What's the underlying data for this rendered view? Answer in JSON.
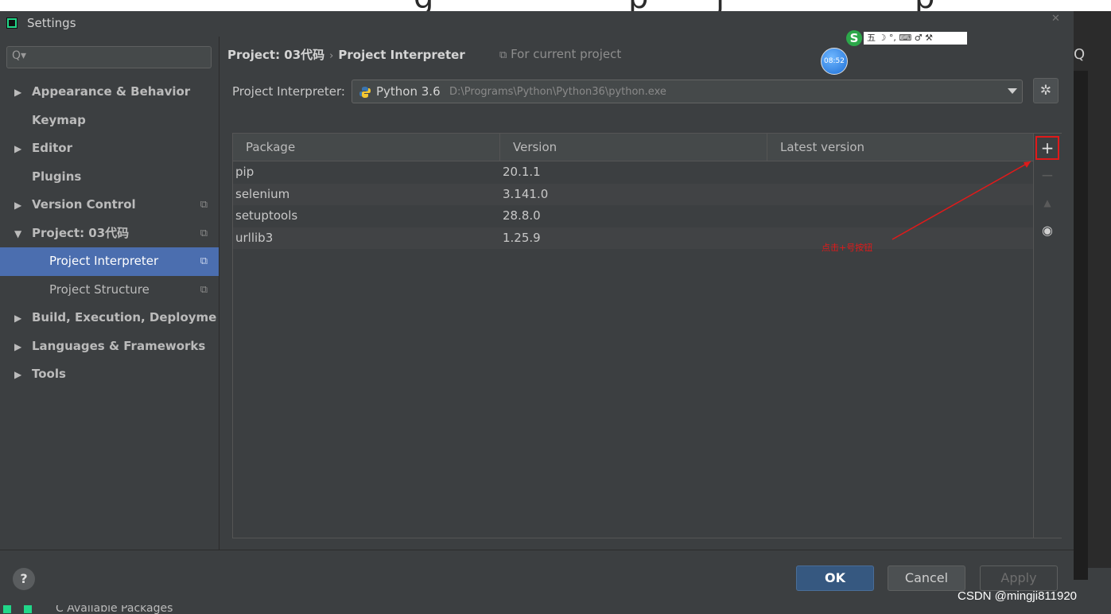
{
  "window": {
    "title": "Settings"
  },
  "sidebar": {
    "items": [
      {
        "label": "Appearance & Behavior",
        "arrow": "▶"
      },
      {
        "label": "Keymap",
        "arrow": ""
      },
      {
        "label": "Editor",
        "arrow": "▶"
      },
      {
        "label": "Plugins",
        "arrow": ""
      },
      {
        "label": "Version Control",
        "arrow": "▶"
      },
      {
        "label": "Project: 03代码",
        "arrow": "▼"
      },
      {
        "label": "Project Interpreter",
        "arrow": ""
      },
      {
        "label": "Project Structure",
        "arrow": ""
      },
      {
        "label": "Build, Execution, Deployme",
        "arrow": "▶"
      },
      {
        "label": "Languages & Frameworks",
        "arrow": "▶"
      },
      {
        "label": "Tools",
        "arrow": "▶"
      }
    ]
  },
  "header": {
    "project": "Project: 03代码",
    "separator": "›",
    "page": "Project Interpreter",
    "scope": "For current project"
  },
  "ime": {
    "brand": "S",
    "text": "五 ☽ °, ⌨ ♂ ⚒"
  },
  "clock": {
    "time": "08:52"
  },
  "interpreter": {
    "label": "Project Interpreter:",
    "name": "Python 3.6",
    "path": "D:\\Programs\\Python\\Python36\\python.exe"
  },
  "packages": {
    "columns": [
      "Package",
      "Version",
      "Latest version"
    ],
    "rows": [
      {
        "name": "pip",
        "version": "20.1.1",
        "latest": ""
      },
      {
        "name": "selenium",
        "version": "3.141.0",
        "latest": ""
      },
      {
        "name": "setuptools",
        "version": "28.8.0",
        "latest": ""
      },
      {
        "name": "urllib3",
        "version": "1.25.9",
        "latest": ""
      }
    ]
  },
  "toolbar": {
    "add": "+",
    "remove": "−",
    "upgrade": "▲",
    "show": "◉"
  },
  "annotation": {
    "text": "点击+号按钮",
    "color": "#e01a1a"
  },
  "footer": {
    "help": "?",
    "ok": "OK",
    "cancel": "Cancel",
    "apply": "Apply"
  },
  "taskbar": {
    "text": "C  Available Packages"
  },
  "watermark": "CSDN @mingji811920",
  "colors": {
    "selection": "#4b6eaf",
    "ok_button": "#365880",
    "annotation": "#e01a1a",
    "background": "#3c3f41"
  }
}
